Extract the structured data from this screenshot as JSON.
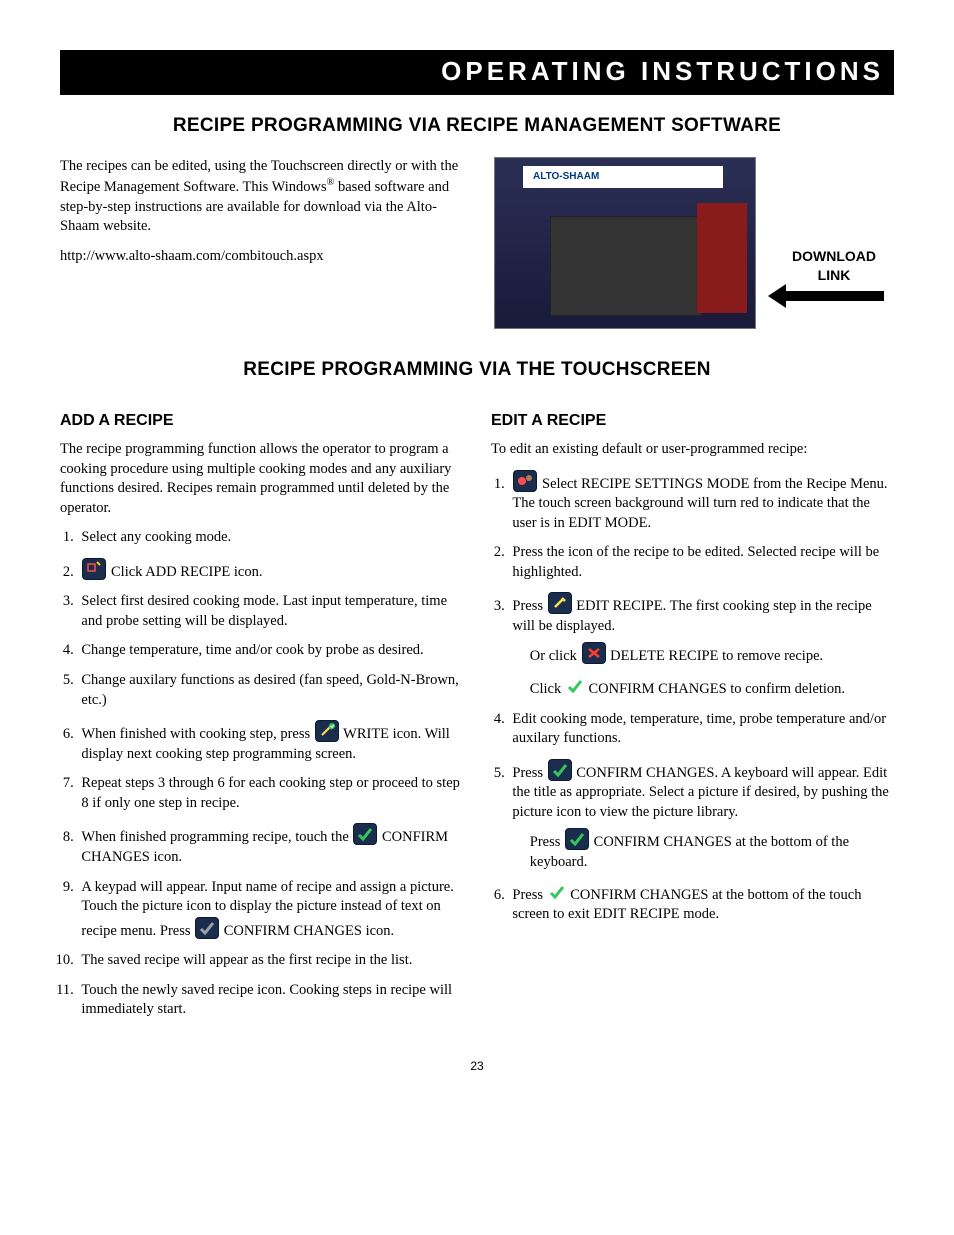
{
  "banner": "OPERATING INSTRUCTIONS",
  "h1a": "RECIPE PROGRAMMING VIA RECIPE MANAGEMENT SOFTWARE",
  "intro": {
    "p1a": "The recipes can be edited, using the Touchscreen directly or with the Recipe Management Software.  This Windows",
    "reg": "®",
    "p1b": " based software and step-by-step instructions are available for download via the Alto-Shaam website.",
    "url": "http://www.alto-shaam.com/combitouch.aspx"
  },
  "logo": "ALTO-SHAAM",
  "dl1": "DOWNLOAD",
  "dl2": "LINK",
  "h1b": "RECIPE PROGRAMMING VIA THE TOUCHSCREEN",
  "add": {
    "heading": "ADD A RECIPE",
    "intro": "The recipe programming function allows the operator to program a cooking procedure using multiple cooking modes and any auxiliary functions desired. Recipes remain programmed until deleted by the operator.",
    "s1": "Select any cooking mode.",
    "s2": "Click ADD RECIPE icon.",
    "s3": "Select first desired cooking mode. Last input temperature, time and probe setting will be displayed.",
    "s4": "Change temperature, time and/or cook by probe as desired.",
    "s5": "Change auxilary functions as desired (fan speed, Gold-N-Brown, etc.)",
    "s6a": "When finished with cooking step, press ",
    "s6b": " WRITE icon. Will display next cooking step programming screen.",
    "s7": "Repeat steps 3 through 6 for each cooking step or proceed to step 8 if only one step in recipe.",
    "s8a": "When finished programming recipe, touch the ",
    "s8b": " CONFIRM CHANGES icon.",
    "s9a": "A keypad will appear. Input name of recipe and assign a picture. Touch the picture icon to display the picture instead of text on recipe menu. Press ",
    "s9b": " CONFIRM CHANGES icon.",
    "s10": "The saved recipe will appear as the first recipe in the list.",
    "s11": "Touch the newly saved recipe icon. Cooking steps in recipe will immediately start."
  },
  "edit": {
    "heading": "EDIT A RECIPE",
    "intro": "To edit an existing default or user-programmed recipe:",
    "s1a": "Select RECIPE SETTINGS MODE from the Recipe Menu. The touch screen background will turn red to indicate that the user is in EDIT MODE.",
    "s2": "Press the icon of the recipe to be edited. Selected recipe will be highlighted.",
    "s3a": "Press ",
    "s3b": " EDIT RECIPE. The first cooking step in the recipe will be displayed.",
    "s3c": "Or click ",
    "s3d": " DELETE RECIPE to remove recipe.",
    "s3e": "Click ",
    "s3f": " CONFIRM CHANGES to confirm deletion.",
    "s4": "Edit cooking mode, temperature, time, probe temperature and/or auxilary functions.",
    "s5a": "Press ",
    "s5b": " CONFIRM CHANGES. A keyboard will appear. Edit the title as appropriate. Select a picture if desired, by pushing the picture icon to view the picture library.",
    "s5c": "Press ",
    "s5d": " CONFIRM CHANGES at the bottom of the keyboard.",
    "s6a": "Press ",
    "s6b": " CONFIRM CHANGES at the bottom of the touch screen to exit EDIT RECIPE mode."
  },
  "page": "23"
}
